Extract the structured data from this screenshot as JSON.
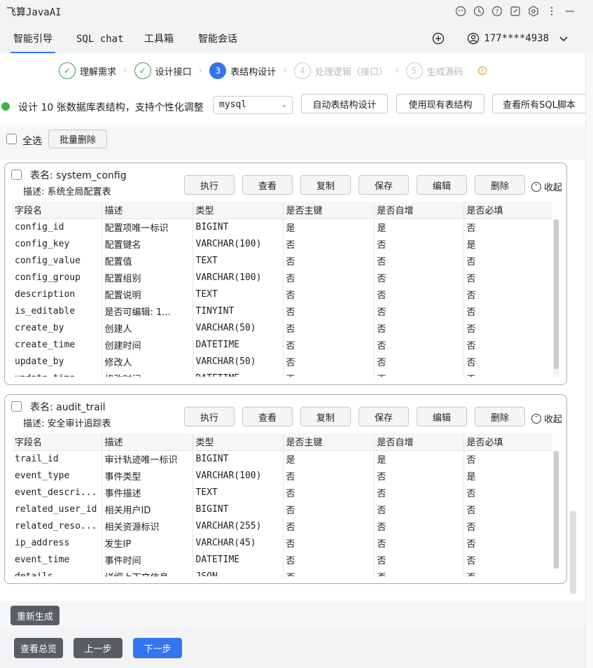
{
  "app": {
    "title": "飞算JavaAI"
  },
  "nav": {
    "tabs": [
      "智能引导",
      "SQL chat",
      "工具箱",
      "智能会话"
    ],
    "user": "177****4938"
  },
  "steps": [
    {
      "num": "✓",
      "label": "理解需求",
      "state": "done"
    },
    {
      "num": "✓",
      "label": "设计接口",
      "state": "done"
    },
    {
      "num": "3",
      "label": "表结构设计",
      "state": "current"
    },
    {
      "num": "4",
      "label": "处理逻辑（接口）",
      "state": "todo"
    },
    {
      "num": "5",
      "label": "生成源码",
      "state": "todo"
    }
  ],
  "info": {
    "text": "设计 10 张数据库表结构，支持个性化调整",
    "db_select": "mysql",
    "buttons": [
      "自动表结构设计",
      "使用现有表结构",
      "查看所有SQL脚本"
    ]
  },
  "bulk": {
    "select_all": "全选",
    "batch_delete": "批量删除"
  },
  "card_actions": [
    "执行",
    "查看",
    "复制",
    "保存",
    "编辑",
    "删除"
  ],
  "collapse_label": "收起",
  "columns": [
    "字段名",
    "描述",
    "类型",
    "是否主键",
    "是否自增",
    "是否必填"
  ],
  "tables": [
    {
      "name_label": "表名: system_config",
      "desc_label": "描述: 系统全局配置表",
      "rows": [
        [
          "config_id",
          "配置项唯一标识",
          "BIGINT",
          "是",
          "是",
          "否"
        ],
        [
          "config_key",
          "配置键名",
          "VARCHAR(100)",
          "否",
          "否",
          "是"
        ],
        [
          "config_value",
          "配置值",
          "TEXT",
          "否",
          "否",
          "否"
        ],
        [
          "config_group",
          "配置组别",
          "VARCHAR(100)",
          "否",
          "否",
          "否"
        ],
        [
          "description",
          "配置说明",
          "TEXT",
          "否",
          "否",
          "否"
        ],
        [
          "is_editable",
          "是否可编辑: 1...",
          "TINYINT",
          "否",
          "否",
          "否"
        ],
        [
          "create_by",
          "创建人",
          "VARCHAR(50)",
          "否",
          "否",
          "否"
        ],
        [
          "create_time",
          "创建时间",
          "DATETIME",
          "否",
          "否",
          "否"
        ],
        [
          "update_by",
          "修改人",
          "VARCHAR(50)",
          "否",
          "否",
          "否"
        ],
        [
          "update_time",
          "修改时间",
          "DATETIME",
          "否",
          "否",
          "否"
        ]
      ]
    },
    {
      "name_label": "表名: audit_trail",
      "desc_label": "描述: 安全审计追踪表",
      "rows": [
        [
          "trail_id",
          "审计轨迹唯一标识",
          "BIGINT",
          "是",
          "是",
          "否"
        ],
        [
          "event_type",
          "事件类型",
          "VARCHAR(100)",
          "否",
          "否",
          "是"
        ],
        [
          "event_descri...",
          "事件描述",
          "TEXT",
          "否",
          "否",
          "否"
        ],
        [
          "related_user_id",
          "相关用户ID",
          "BIGINT",
          "否",
          "否",
          "否"
        ],
        [
          "related_reso...",
          "相关资源标识",
          "VARCHAR(255)",
          "否",
          "否",
          "否"
        ],
        [
          "ip_address",
          "发生IP",
          "VARCHAR(45)",
          "否",
          "否",
          "否"
        ],
        [
          "event_time",
          "事件时间",
          "DATETIME",
          "否",
          "否",
          "否"
        ],
        [
          "details",
          "详细上下文信息",
          "JSON",
          "否",
          "否",
          "否"
        ]
      ]
    }
  ],
  "footer": {
    "regenerate": "重新生成",
    "overview": "查看总览",
    "prev": "上一步",
    "next": "下一步"
  }
}
